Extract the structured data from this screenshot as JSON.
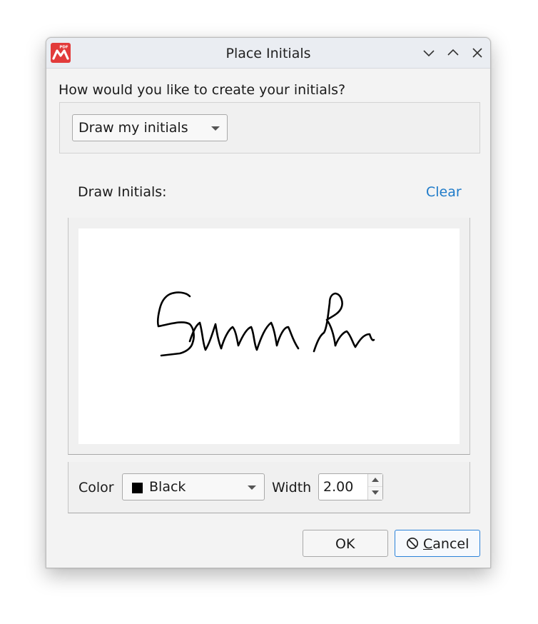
{
  "window": {
    "title": "Place Initials",
    "app_icon": "pdf-app-icon",
    "app_icon_badge": "PDF",
    "accent_color": "#e23b3b"
  },
  "prompt": "How would you like to create your initials?",
  "method_select": {
    "selected": "Draw my initials"
  },
  "draw_section": {
    "label": "Draw Initials:",
    "clear_label": "Clear",
    "link_color": "#1f7bc9"
  },
  "options": {
    "color_label": "Color",
    "color_value": "Black",
    "swatch_color": "#000000",
    "width_label": "Width",
    "width_value": "2.00"
  },
  "buttons": {
    "ok_label": "OK",
    "cancel_mnemonic": "C",
    "cancel_rest": "ancel",
    "cancel_border_color": "#2b82d9"
  }
}
